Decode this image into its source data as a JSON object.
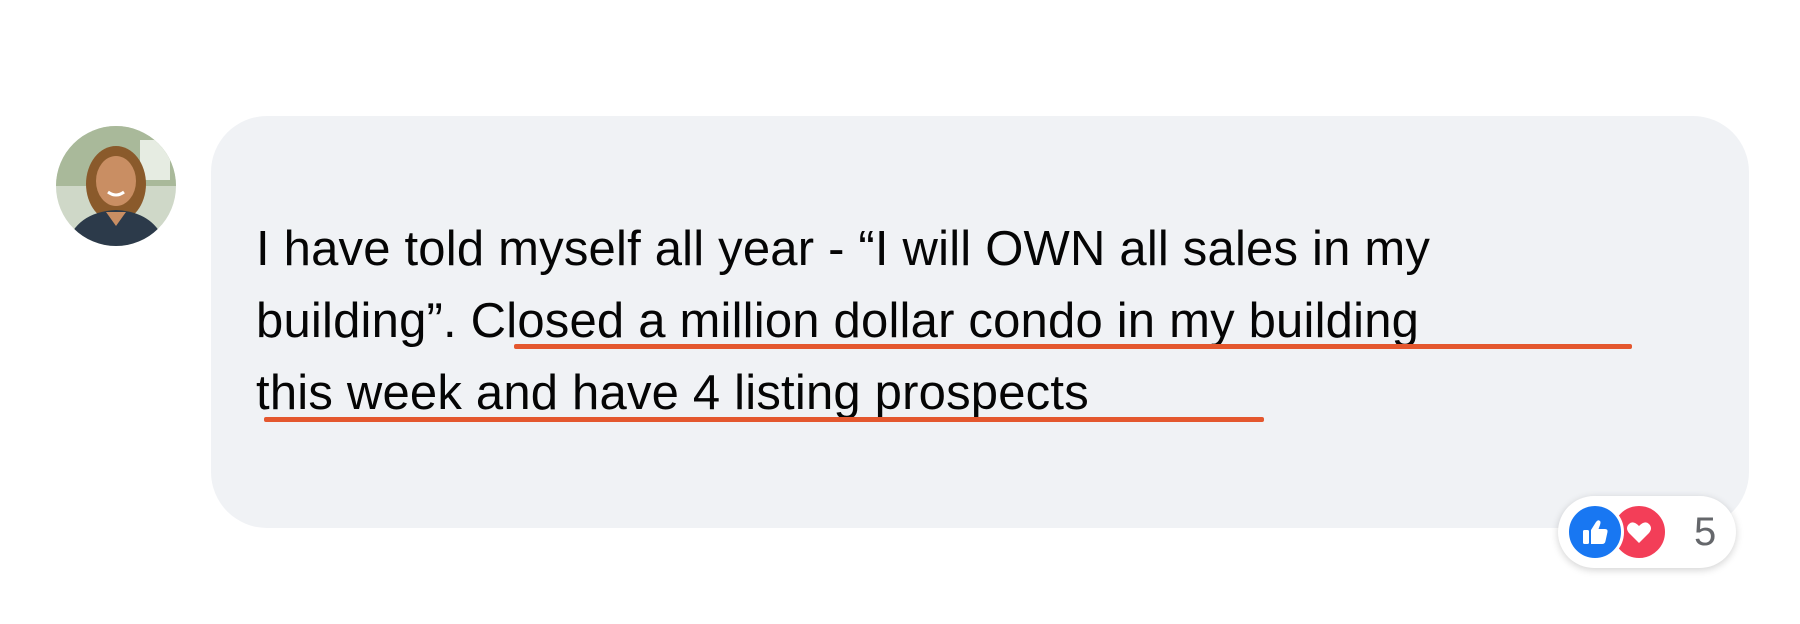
{
  "comment": {
    "lines": [
      "I have told myself all year - “I will OWN all sales in my",
      "building”. Closed a million dollar condo in my building",
      "this week and have 4 listing prospects"
    ],
    "highlight_color": "#e4572e",
    "bubble_color": "#f0f2f5"
  },
  "reactions": {
    "icons": [
      "like-icon",
      "love-icon"
    ],
    "count": "5",
    "colors": {
      "like": "#1877f2",
      "love": "#f33e58"
    }
  }
}
